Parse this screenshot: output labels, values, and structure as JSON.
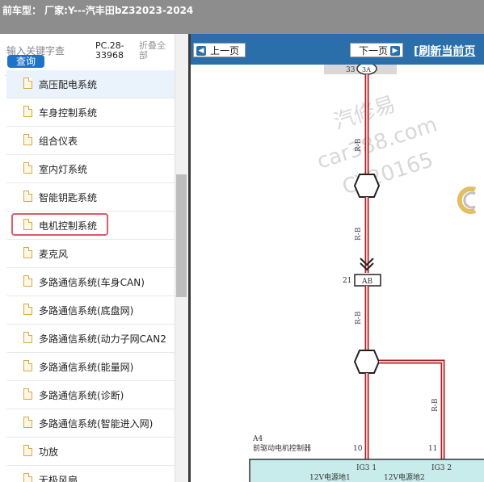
{
  "header": {
    "title": "前车型： 厂家:Y---汽丰田bZ32023-2024"
  },
  "sidebar": {
    "search_placeholder": "输入关键字查",
    "search_button": "查询",
    "pc_code": "PC.28-33968",
    "collapse_all": "折叠全部",
    "items": [
      {
        "label": "高压配电系统"
      },
      {
        "label": "车身控制系统"
      },
      {
        "label": "组合仪表"
      },
      {
        "label": "室内灯系统"
      },
      {
        "label": "智能钥匙系统"
      },
      {
        "label": "电机控制系统"
      },
      {
        "label": "麦克风"
      },
      {
        "label": "多路通信系统(车身CAN)"
      },
      {
        "label": "多路通信系统(底盘网)"
      },
      {
        "label": "多路通信系统(动力子网CAN2"
      },
      {
        "label": "多路通信系统(能量网)"
      },
      {
        "label": "多路通信系统(诊断)"
      },
      {
        "label": "多路通信系统(智能进入网)"
      },
      {
        "label": "功放"
      },
      {
        "label": "无极风扇"
      }
    ],
    "highlighted_item": "电机控制系统"
  },
  "toolbar": {
    "prev_label": "上一页",
    "next_label": "下一页",
    "refresh_label": "[刷新当前页"
  },
  "diagram": {
    "top_pin": "33",
    "top_connector": "3A",
    "wire_color_top": "R-B",
    "wire_color_mid": "R-B",
    "connector_pin": "21",
    "connector_name": "AB",
    "wire_color_lower_left": "R-B",
    "wire_color_lower_right": "R-B",
    "component_code": "A4",
    "component_name": "前驱动电机控制器",
    "pin_left": "10",
    "pin_right": "11",
    "terminal_left": "IG3 1",
    "terminal_right": "IG3 2",
    "bottom_label_left": "12V电源地1",
    "bottom_label_right": "12V电源地2",
    "watermark_lines": [
      "汽修易",
      "car388.com",
      "CY20165"
    ],
    "colors": {
      "wire": "#b02020",
      "component_fill": "#c8ecec",
      "navbar": "#2a6faa"
    }
  }
}
